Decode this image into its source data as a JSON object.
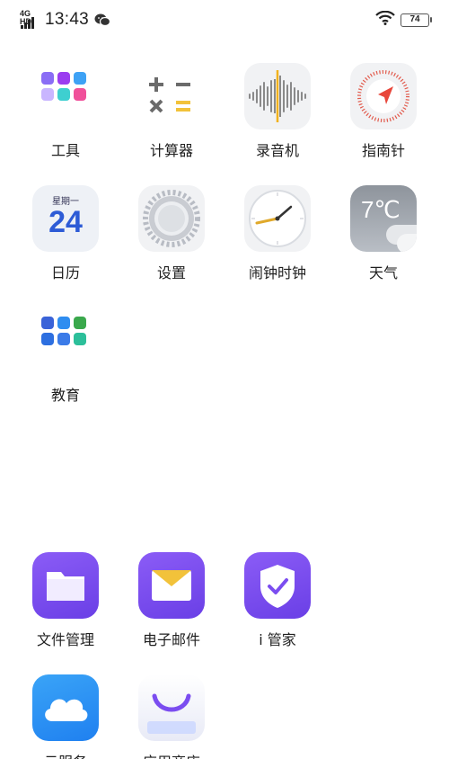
{
  "status_bar": {
    "network": "4G HD",
    "time": "13:43",
    "battery": "74"
  },
  "apps": [
    {
      "label": "工具"
    },
    {
      "label": "计算器"
    },
    {
      "label": "录音机"
    },
    {
      "label": "指南针"
    },
    {
      "label": "日历",
      "calendar_weekday": "星期一",
      "calendar_day": "24"
    },
    {
      "label": "设置"
    },
    {
      "label": "闹钟时钟"
    },
    {
      "label": "天气",
      "weather_temp": "7℃"
    },
    {
      "label": "教育"
    },
    {
      "label": "文件管理"
    },
    {
      "label": "电子邮件"
    },
    {
      "label": "i 管家"
    },
    {
      "label": "云服务"
    },
    {
      "label": "应用商店"
    }
  ],
  "colors": {
    "purple": "#7b4df0",
    "blue": "#2a8ef5",
    "gold": "#f2c23a"
  }
}
